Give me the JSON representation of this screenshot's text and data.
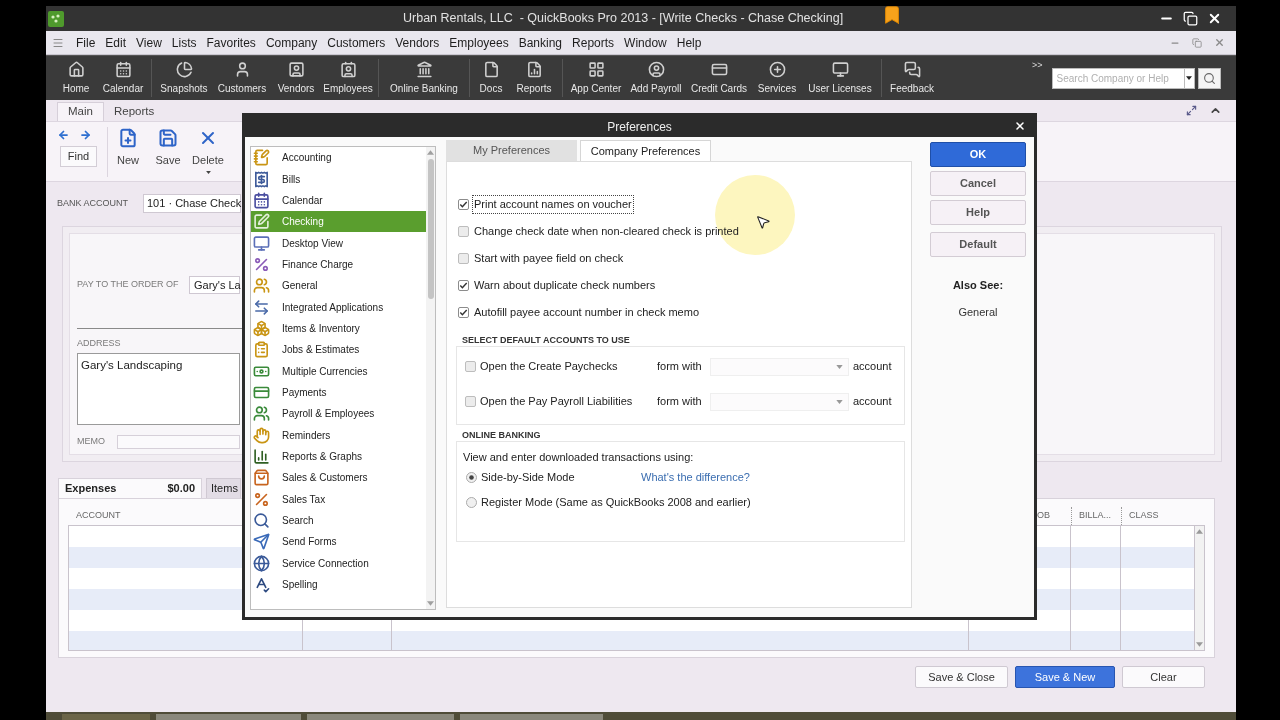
{
  "window": {
    "title": "Urban Rentals, LLC  - QuickBooks Pro 2013 - [Write Checks - Chase Checking]"
  },
  "menu": [
    "File",
    "Edit",
    "View",
    "Lists",
    "Favorites",
    "Company",
    "Customers",
    "Vendors",
    "Employees",
    "Banking",
    "Reports",
    "Window",
    "Help"
  ],
  "toolbar": {
    "groups": [
      [
        "Home",
        "Calendar"
      ],
      [
        "Snapshots",
        "Customers",
        "Vendors",
        "Employees"
      ],
      [
        "Online Banking"
      ],
      [
        "Docs",
        "Reports"
      ],
      [
        "App Center",
        "Add Payroll",
        "Credit Cards",
        "Services",
        "User Licenses"
      ],
      [
        "Feedback"
      ]
    ],
    "overflow": ">>",
    "search": {
      "placeholder": "Search Company or Help"
    }
  },
  "write_checks": {
    "tabs": [
      {
        "label": "Main",
        "selected": true
      },
      {
        "label": "Reports",
        "selected": false
      }
    ],
    "actions": [
      {
        "label": "Find",
        "kind": "find"
      },
      {
        "label": "New",
        "kind": "tool"
      },
      {
        "label": "Save",
        "kind": "tool"
      },
      {
        "label": "Delete",
        "kind": "tool_menu"
      }
    ],
    "bank_account": {
      "label": "BANK ACCOUNT",
      "value": "101 · Chase Check"
    },
    "check": {
      "pay_to_label": "PAY TO THE ORDER OF",
      "payee": "Gary's La",
      "address_label": "ADDRESS",
      "address": "Gary's Landscaping",
      "memo_label": "MEMO"
    },
    "detail_tabs": [
      {
        "label": "Expenses",
        "amount": "$0.00",
        "selected": true
      },
      {
        "label": "Items",
        "selected": false
      }
    ],
    "table": {
      "columns": [
        "ACCOUNT",
        "OB",
        "BILLA...",
        "CLASS"
      ]
    },
    "buttons": [
      {
        "label": "Save & Close",
        "kind": "secondary"
      },
      {
        "label": "Save & New",
        "kind": "primary"
      },
      {
        "label": "Clear",
        "kind": "secondary"
      }
    ]
  },
  "preferences": {
    "title": "Preferences",
    "categories": [
      {
        "label": "Accounting",
        "selected": false
      },
      {
        "label": "Bills",
        "selected": false
      },
      {
        "label": "Calendar",
        "selected": false
      },
      {
        "label": "Checking",
        "selected": true
      },
      {
        "label": "Desktop View",
        "selected": false
      },
      {
        "label": "Finance Charge",
        "selected": false
      },
      {
        "label": "General",
        "selected": false
      },
      {
        "label": "Integrated Applications",
        "selected": false
      },
      {
        "label": "Items & Inventory",
        "selected": false
      },
      {
        "label": "Jobs & Estimates",
        "selected": false
      },
      {
        "label": "Multiple Currencies",
        "selected": false
      },
      {
        "label": "Payments",
        "selected": false
      },
      {
        "label": "Payroll & Employees",
        "selected": false
      },
      {
        "label": "Reminders",
        "selected": false
      },
      {
        "label": "Reports & Graphs",
        "selected": false
      },
      {
        "label": "Sales & Customers",
        "selected": false
      },
      {
        "label": "Sales Tax",
        "selected": false
      },
      {
        "label": "Search",
        "selected": false
      },
      {
        "label": "Send Forms",
        "selected": false
      },
      {
        "label": "Service Connection",
        "selected": false
      },
      {
        "label": "Spelling",
        "selected": false
      }
    ],
    "tabs": [
      {
        "label": "My Preferences",
        "selected": false
      },
      {
        "label": "Company Preferences",
        "selected": true
      }
    ],
    "options": [
      {
        "label": "Print account names on voucher",
        "checked": true,
        "focused": true
      },
      {
        "label": "Change check date when non-cleared check is printed",
        "checked": false,
        "focused": false
      },
      {
        "label": "Start with payee field on check",
        "checked": false,
        "focused": false
      },
      {
        "label": "Warn about duplicate check numbers",
        "checked": true,
        "focused": false
      },
      {
        "label": "Autofill payee account number in check memo",
        "checked": true,
        "focused": false
      }
    ],
    "default_accounts": {
      "heading": "SELECT DEFAULT ACCOUNTS TO USE",
      "rows": [
        {
          "label": "Open the Create Paychecks",
          "checked": false,
          "connector": "form with",
          "suffix": "account"
        },
        {
          "label": "Open the Pay Payroll Liabilities",
          "checked": false,
          "connector": "form with",
          "suffix": "account"
        }
      ]
    },
    "online_banking": {
      "heading": "ONLINE BANKING",
      "prompt": "View and enter downloaded transactions using:",
      "modes": [
        {
          "label": "Side-by-Side Mode",
          "selected": true,
          "link": "What's the difference?"
        },
        {
          "label": "Register Mode (Same as QuickBooks 2008 and earlier)",
          "selected": false
        }
      ]
    },
    "buttons": [
      {
        "label": "OK",
        "kind": "primary"
      },
      {
        "label": "Cancel",
        "kind": "secondary"
      },
      {
        "label": "Help",
        "kind": "secondary"
      },
      {
        "label": "Default",
        "kind": "secondary"
      }
    ],
    "also_see": {
      "heading": "Also See:",
      "links": [
        "General"
      ]
    }
  }
}
